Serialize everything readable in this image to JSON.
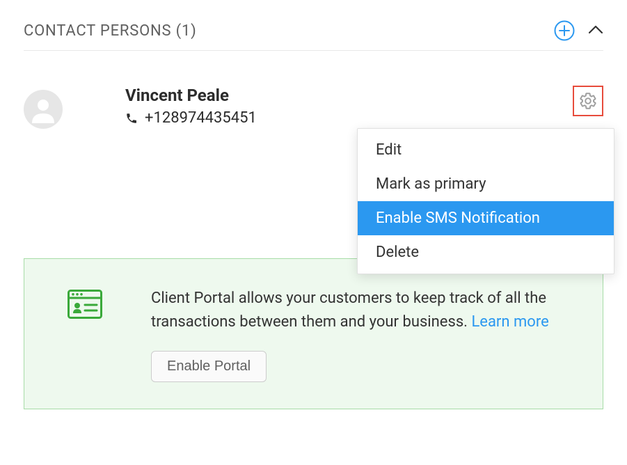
{
  "header": {
    "title": "CONTACT PERSONS (1)"
  },
  "contact": {
    "name": "Vincent Peale",
    "phone": "+128974435451"
  },
  "menu": {
    "edit": "Edit",
    "mark_primary": "Mark as primary",
    "enable_sms": "Enable SMS Notification",
    "delete": "Delete"
  },
  "portal": {
    "body": "Client Portal allows your customers to keep track of all the transactions between them and your business. ",
    "learn_more": "Learn more",
    "button": "Enable Portal"
  }
}
